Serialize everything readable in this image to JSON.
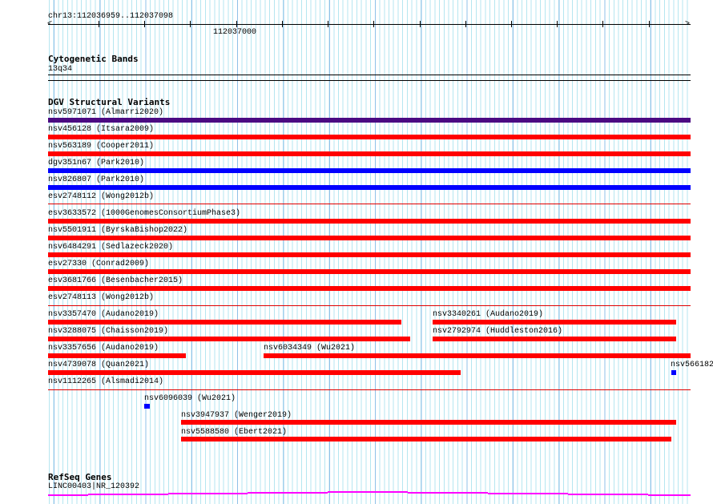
{
  "ruler": {
    "range": "chr13:112036959..112037098",
    "tick_label": "112037000"
  },
  "cytobands": {
    "title": "Cytogenetic Bands",
    "band": "13q34"
  },
  "dgv": {
    "title": "DGV Structural Variants",
    "variants": [
      "nsv5971071 (Almarri2020)",
      "nsv456128 (Itsara2009)",
      "nsv563189 (Cooper2011)",
      "dgv351n67 (Park2010)",
      "nsv826807 (Park2010)",
      "esv2748112 (Wong2012b)",
      "esv3633572 (1000GenomesConsortiumPhase3)",
      "nsv5501911 (ByrskaBishop2022)",
      "nsv6484291 (Sedlazeck2020)",
      "esv27330 (Conrad2009)",
      "esv3681766 (Besenbacher2015)",
      "esv2748113 (Wong2012b)",
      "nsv3357470 (Audano2019)",
      "nsv3340261 (Audano2019)",
      "nsv3288075 (Chaisson2019)",
      "nsv2792974 (Huddleston2016)",
      "nsv3357656 (Audano2019)",
      "nsv6034349 (Wu2021)",
      "nsv4739078 (Quan2021)",
      "nsv566182",
      "nsv1112265 (Alsmadi2014)",
      "nsv6096039 (Wu2021)",
      "nsv3947937 (Wenger2019)",
      "nsv5588580 (Ebert2021)"
    ]
  },
  "refseq": {
    "title": "RefSeq Genes",
    "gene": "LINC00403|NR_120392"
  },
  "colors": {
    "loss": "#ff0000",
    "gain": "#0000ff",
    "complex": "#4b0a82",
    "gene": "#ff00ff"
  }
}
